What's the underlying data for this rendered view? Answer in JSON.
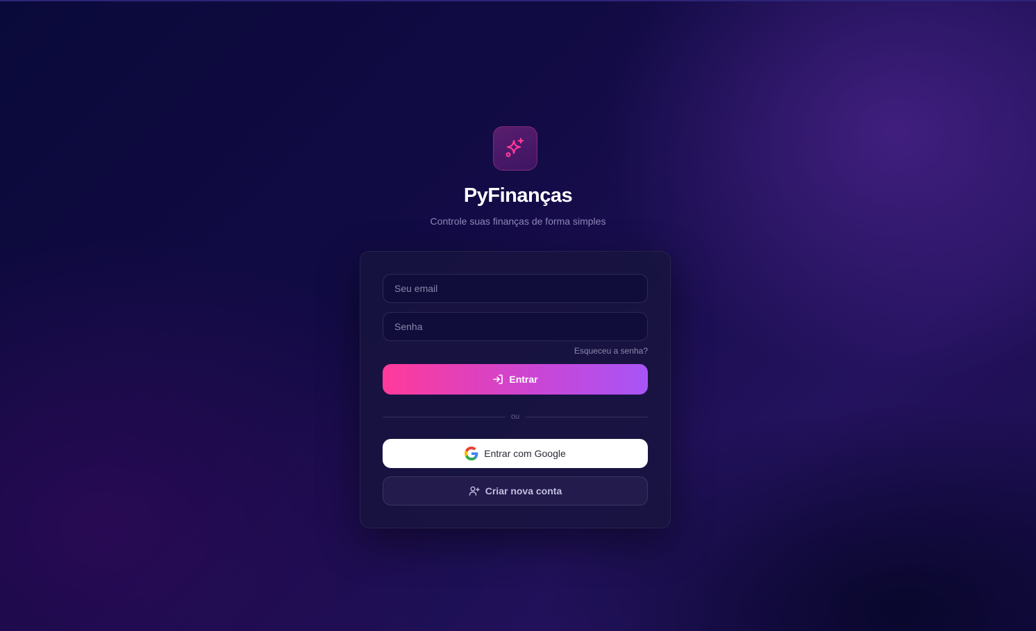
{
  "brand": {
    "logo_icon": "sparkles-icon",
    "title": "PyFinanças",
    "subtitle": "Controle suas finanças de forma simples"
  },
  "form": {
    "email_placeholder": "Seu email",
    "password_placeholder": "Senha",
    "forgot_label": "Esqueceu a senha?",
    "login_label": "Entrar",
    "divider_label": "ou",
    "google_label": "Entrar com Google",
    "create_label": "Criar nova conta"
  },
  "colors": {
    "accent_pink": "#ff3a9a",
    "accent_purple": "#a855f7",
    "background": "#0a0a3a"
  }
}
